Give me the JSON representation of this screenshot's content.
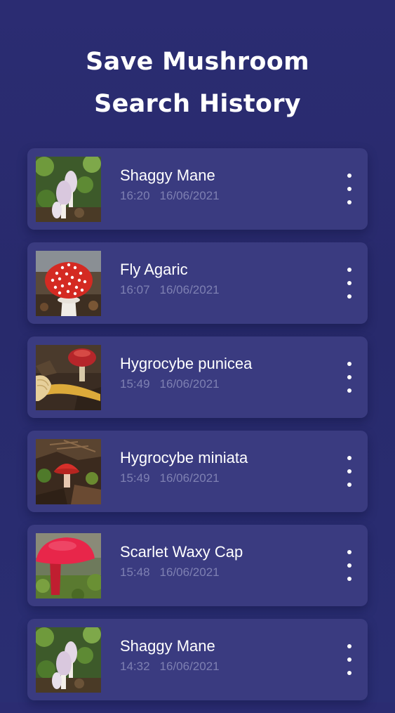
{
  "header": {
    "title_line1": "Save Mushroom",
    "title_line2": "Search History"
  },
  "history": [
    {
      "name": "Shaggy Mane",
      "time": "16:20",
      "date": "16/06/2021",
      "image": "shaggy-mane-photo"
    },
    {
      "name": "Fly Agaric",
      "time": "16:07",
      "date": "16/06/2021",
      "image": "fly-agaric-photo"
    },
    {
      "name": "Hygrocybe punicea",
      "time": "15:49",
      "date": "16/06/2021",
      "image": "hygrocybe-punicea-photo"
    },
    {
      "name": "Hygrocybe miniata",
      "time": "15:49",
      "date": "16/06/2021",
      "image": "hygrocybe-miniata-photo"
    },
    {
      "name": "Scarlet Waxy Cap",
      "time": "15:48",
      "date": "16/06/2021",
      "image": "scarlet-waxy-cap-photo"
    },
    {
      "name": "Shaggy Mane",
      "time": "14:32",
      "date": "16/06/2021",
      "image": "shaggy-mane-photo"
    }
  ],
  "icons": {
    "more": "more-vertical-icon"
  },
  "colors": {
    "background": "#2a2c70",
    "card": "#3a3b80",
    "title_text": "#ffffff",
    "meta_text": "#7e80b2"
  }
}
